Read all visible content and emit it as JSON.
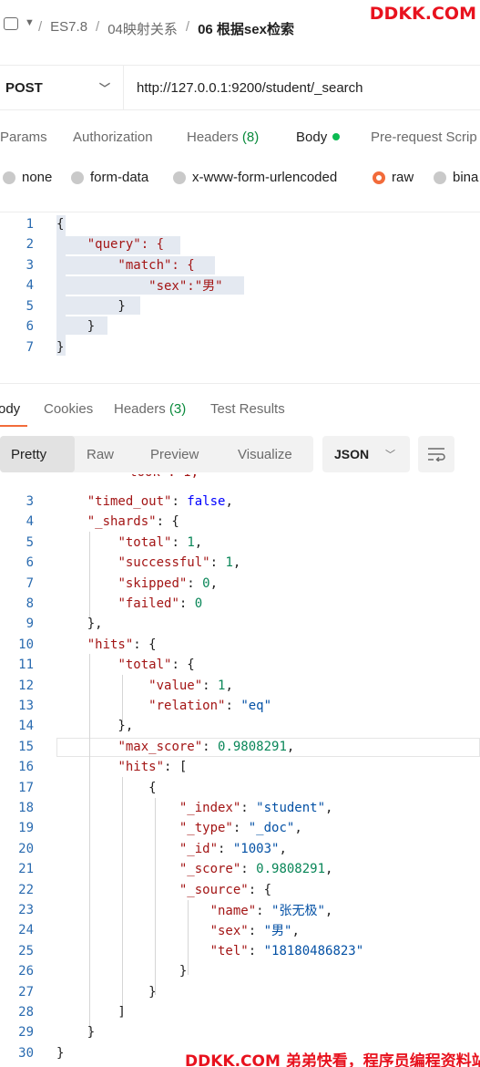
{
  "breadcrumb": {
    "items": [
      "ES7.8",
      "04映射关系"
    ],
    "current": "06 根据sex检索",
    "separator": "/"
  },
  "watermark": {
    "top": "DDKK.COM",
    "bottom": "DDKK.COM 弟弟快看，程序员编程资料站"
  },
  "request": {
    "method": "POST",
    "url": "http://127.0.0.1:9200/student/_search"
  },
  "request_tabs": [
    {
      "label": "Params"
    },
    {
      "label": "Authorization"
    },
    {
      "label": "Headers",
      "count": "(8)"
    },
    {
      "label": "Body"
    },
    {
      "label": "Pre-request Scrip"
    }
  ],
  "body_types": [
    "none",
    "form-data",
    "x-www-form-urlencoded",
    "raw",
    "bina"
  ],
  "selected_body_type": "raw",
  "request_body": [
    {
      "n": "1",
      "code": "{"
    },
    {
      "n": "2",
      "code": "    \"query\": {"
    },
    {
      "n": "3",
      "code": "        \"match\": {"
    },
    {
      "n": "4",
      "code": "            \"sex\":\"男\""
    },
    {
      "n": "5",
      "code": "        }"
    },
    {
      "n": "6",
      "code": "    }"
    },
    {
      "n": "7",
      "code": "}"
    }
  ],
  "response_tabs": [
    {
      "label": "ody"
    },
    {
      "label": "Cookies"
    },
    {
      "label": "Headers",
      "count": "(3)"
    },
    {
      "label": "Test Results"
    }
  ],
  "view_modes": [
    "Pretty",
    "Raw",
    "Preview",
    "Visualize"
  ],
  "format": "JSON",
  "response_body": [
    {
      "n": "3",
      "code": "    \"timed_out\": false,"
    },
    {
      "n": "4",
      "code": "    \"_shards\": {"
    },
    {
      "n": "5",
      "code": "        \"total\": 1,"
    },
    {
      "n": "6",
      "code": "        \"successful\": 1,"
    },
    {
      "n": "7",
      "code": "        \"skipped\": 0,"
    },
    {
      "n": "8",
      "code": "        \"failed\": 0"
    },
    {
      "n": "9",
      "code": "    },"
    },
    {
      "n": "10",
      "code": "    \"hits\": {"
    },
    {
      "n": "11",
      "code": "        \"total\": {"
    },
    {
      "n": "12",
      "code": "            \"value\": 1,"
    },
    {
      "n": "13",
      "code": "            \"relation\": \"eq\""
    },
    {
      "n": "14",
      "code": "        },"
    },
    {
      "n": "15",
      "code": "        \"max_score\": 0.9808291,"
    },
    {
      "n": "16",
      "code": "        \"hits\": ["
    },
    {
      "n": "17",
      "code": "            {"
    },
    {
      "n": "18",
      "code": "                \"_index\": \"student\","
    },
    {
      "n": "19",
      "code": "                \"_type\": \"_doc\","
    },
    {
      "n": "20",
      "code": "                \"_id\": \"1003\","
    },
    {
      "n": "21",
      "code": "                \"_score\": 0.9808291,"
    },
    {
      "n": "22",
      "code": "                \"_source\": {"
    },
    {
      "n": "23",
      "code": "                    \"name\": \"张无极\","
    },
    {
      "n": "24",
      "code": "                    \"sex\": \"男\","
    },
    {
      "n": "25",
      "code": "                    \"tel\": \"18180486823\""
    },
    {
      "n": "26",
      "code": "                }"
    },
    {
      "n": "27",
      "code": "            }"
    },
    {
      "n": "28",
      "code": "        ]"
    },
    {
      "n": "29",
      "code": "    }"
    },
    {
      "n": "30",
      "code": "}"
    }
  ]
}
